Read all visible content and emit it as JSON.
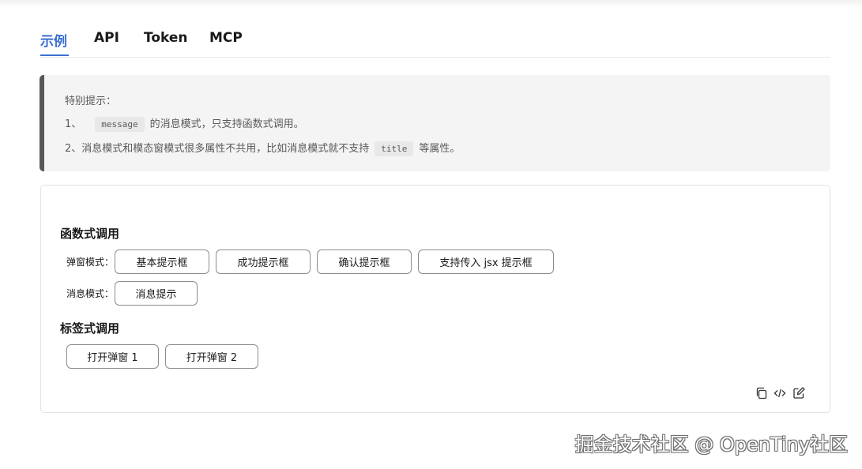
{
  "tabs": [
    {
      "label": "示例",
      "active": true
    },
    {
      "label": "API",
      "active": false
    },
    {
      "label": "Token",
      "active": false
    },
    {
      "label": "MCP",
      "active": false
    }
  ],
  "notice": {
    "title": "特别提示：",
    "line1": {
      "index": "1、",
      "code": "message",
      "text": "的消息模式，只支持函数式调用。"
    },
    "line2": {
      "text_before": "2、消息模式和模态窗模式很多属性不共用，比如消息模式就不支持",
      "code": "title",
      "text_after": "等属性。"
    }
  },
  "demo": {
    "function_section": {
      "title": "函数式调用",
      "modal_row": {
        "label": "弹窗模式：",
        "buttons": [
          "基本提示框",
          "成功提示框",
          "确认提示框",
          "支持传入 jsx 提示框"
        ]
      },
      "message_row": {
        "label": "消息模式：",
        "buttons": [
          "消息提示"
        ]
      }
    },
    "tag_section": {
      "title": "标签式调用",
      "buttons": [
        "打开弹窗 1",
        "打开弹窗 2"
      ]
    },
    "toolbar": [
      "copy-icon",
      "code-icon",
      "edit-icon"
    ]
  },
  "watermark": "掘金技术社区 @ OpenTiny社区",
  "colors": {
    "accent": "#3b6fd1",
    "notice_bg": "#f4f4f4",
    "notice_border": "#575757",
    "button_border": "#8c8c8c"
  }
}
